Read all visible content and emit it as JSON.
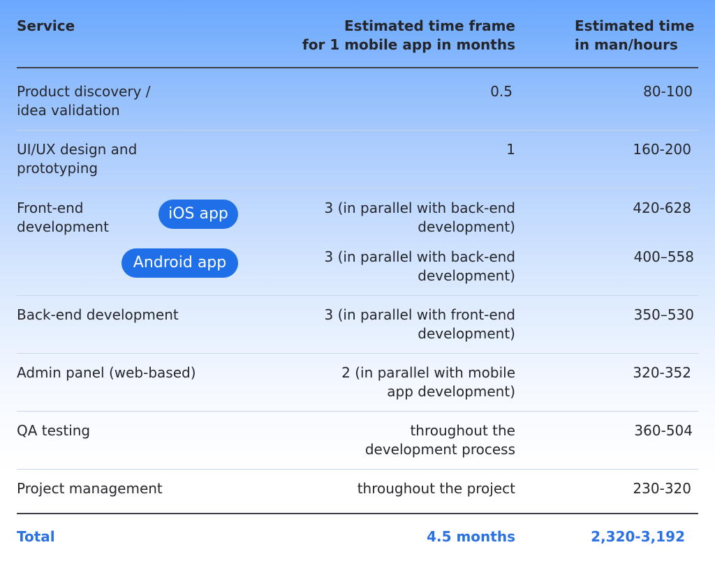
{
  "header": {
    "service": "Service",
    "timeframe": "Estimated time frame\nfor 1 mobile app in months",
    "manhours": "Estimated time\nin man/hours"
  },
  "rows": [
    {
      "service": "Product discovery /\nidea validation",
      "timeframe": "0.5",
      "hours": "80-100"
    },
    {
      "service": "UI/UX design and\nprototyping",
      "timeframe": "1",
      "hours": "160-200"
    },
    {
      "service": "Front-end\ndevelopment",
      "sub": [
        {
          "badge": "iOS app",
          "timeframe": "3 (in parallel with back-end\ndevelopment)",
          "hours": "420-628"
        },
        {
          "badge": "Android app",
          "timeframe": "3 (in parallel with back-end\ndevelopment)",
          "hours": "400–558"
        }
      ]
    },
    {
      "service": "Back-end development",
      "timeframe": "3 (in parallel with front-end\ndevelopment)",
      "hours": "350–530"
    },
    {
      "service": "Admin panel (web-based)",
      "timeframe": "2 (in parallel with mobile\napp development)",
      "hours": "320-352"
    },
    {
      "service": "QA testing",
      "timeframe": "throughout the\ndevelopment process",
      "hours": "360-504"
    },
    {
      "service": "Project management",
      "timeframe": "throughout the project",
      "hours": "230-320"
    }
  ],
  "total": {
    "label": "Total",
    "timeframe": "4.5 months",
    "hours": "2,320-3,192"
  },
  "colors": {
    "accent": "#1e6fe8",
    "total_text": "#2a72e4",
    "text": "#24262b"
  }
}
